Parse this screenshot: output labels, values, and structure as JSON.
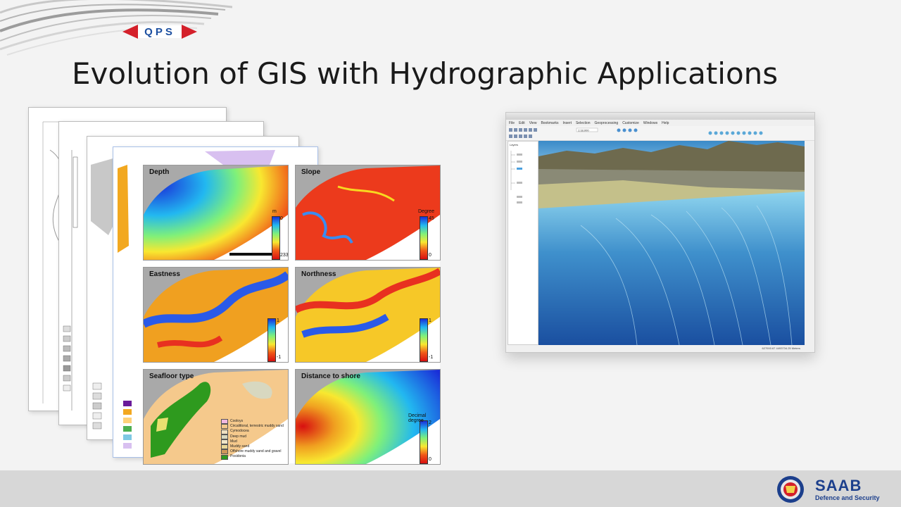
{
  "brand": {
    "logo_text": "QPS"
  },
  "slide": {
    "title": "Evolution of GIS with Hydrographic Applications"
  },
  "panels": [
    {
      "label": "Depth",
      "cb_top": "0",
      "cb_bot": "233",
      "unit": "m"
    },
    {
      "label": "Slope",
      "cb_top": "45",
      "cb_bot": "0",
      "unit": "Degree"
    },
    {
      "label": "Eastness",
      "cb_top": "1",
      "cb_bot": "-1",
      "unit": ""
    },
    {
      "label": "Northness",
      "cb_top": "1",
      "cb_bot": "-1",
      "unit": ""
    },
    {
      "label": "Seafloor type",
      "cb_top": "",
      "cb_bot": "",
      "unit": ""
    },
    {
      "label": "Distance to shore",
      "cb_top": "2",
      "cb_bot": "0",
      "unit": "Decimal degree"
    }
  ],
  "seafloor_legend": [
    {
      "name": "Cooloys",
      "color": "#f2b8e0"
    },
    {
      "name": "Circalittoral, terrestric muddy sand",
      "color": "#f5c98c"
    },
    {
      "name": "Cymodocea",
      "color": "#eedfc0"
    },
    {
      "name": "Deep mud",
      "color": "#d8d8c0"
    },
    {
      "name": "Mud",
      "color": "#f0e6c8"
    },
    {
      "name": "Muddy sand",
      "color": "#e8d898"
    },
    {
      "name": "Offshore muddy sand and gravel",
      "color": "#d09858"
    },
    {
      "name": "Posidonia",
      "color": "#2e9a1e"
    }
  ],
  "gis_window": {
    "menu": [
      "File",
      "Edit",
      "View",
      "Bookmarks",
      "Insert",
      "Selection",
      "Geoprocessing",
      "Customize",
      "Windows",
      "Help"
    ],
    "scale": "1:18,000",
    "toc_title": "Layers",
    "status": "627000.67 4493734.25 Meters"
  },
  "footer": {
    "company": "SAAB",
    "tagline": "Defence and Security"
  },
  "colors": {
    "footer_bg": "#d7d7d7",
    "saab_blue": "#1c3f8c",
    "qps_red": "#d4202a"
  }
}
